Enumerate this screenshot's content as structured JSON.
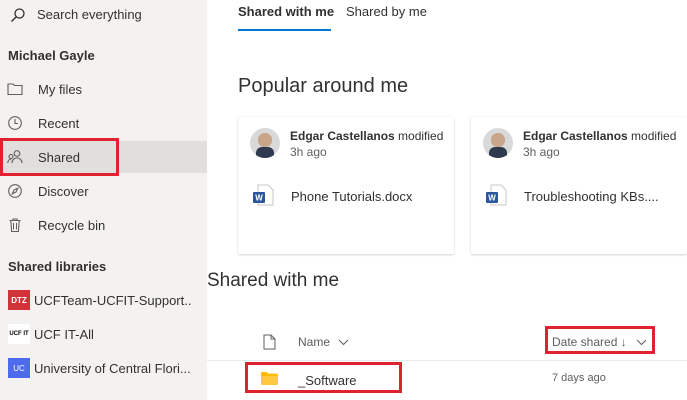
{
  "search": {
    "placeholder": "Search everything",
    "icon": "search-icon"
  },
  "user": {
    "name": "Michael Gayle"
  },
  "nav": [
    {
      "label": "My files",
      "icon": "folder-icon",
      "selected": false
    },
    {
      "label": "Recent",
      "icon": "clock-icon",
      "selected": false
    },
    {
      "label": "Shared",
      "icon": "people-icon",
      "selected": true
    },
    {
      "label": "Discover",
      "icon": "compass-icon",
      "selected": false
    },
    {
      "label": "Recycle bin",
      "icon": "trash-icon",
      "selected": false
    }
  ],
  "libraries": {
    "title": "Shared libraries",
    "items": [
      {
        "label": "UCFTeam-UCFIT-Support...",
        "badge": "DTZ",
        "badge_color": "#d13438"
      },
      {
        "label": "UCF IT-All",
        "badge": "UCF IT",
        "badge_color": "#ffffff"
      },
      {
        "label": "University of Central Flori...",
        "badge": "UC",
        "badge_color": "#4f6bed"
      }
    ]
  },
  "tabs": [
    {
      "label": "Shared with me",
      "active": true
    },
    {
      "label": "Shared by me",
      "active": false
    }
  ],
  "popular": {
    "title": "Popular around me",
    "cards": [
      {
        "person": "Edgar Castellanos",
        "action": "modified",
        "time": "3h ago",
        "file": "Phone Tutorials.docx"
      },
      {
        "person": "Edgar Castellanos",
        "action": "modified",
        "time": "3h ago",
        "file": "Troubleshooting KBs...."
      }
    ]
  },
  "shared_with_me": {
    "title": "Shared with me",
    "columns": {
      "name": "Name",
      "date": "Date shared ↓"
    },
    "rows": [
      {
        "name": "_Software",
        "date": "7 days ago"
      }
    ]
  },
  "colors": {
    "accent": "#0078d4",
    "highlight": "#e0212f",
    "sidebar_bg": "#f3f2f1",
    "selected_bg": "#e1dfdd"
  }
}
